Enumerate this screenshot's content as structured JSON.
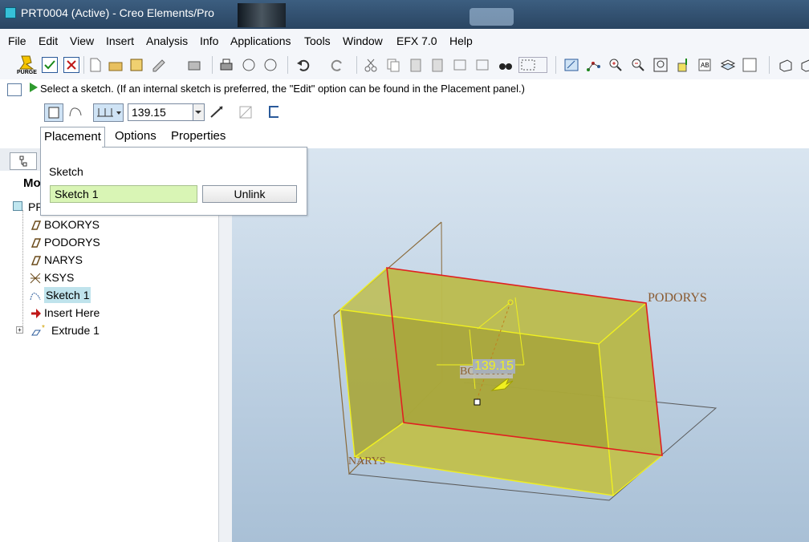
{
  "window": {
    "title": "PRT0004 (Active) - Creo Elements/Pro"
  },
  "menu": [
    "File",
    "Edit",
    "View",
    "Insert",
    "Analysis",
    "Info",
    "Applications",
    "Tools",
    "Window",
    "EFX 7.0",
    "Help"
  ],
  "toolbar": {
    "purge_label": "PURGE"
  },
  "message": {
    "prompt": "Select a sketch. (If an internal sketch is preferred, the \"Edit\" option can be found in the Placement panel.)"
  },
  "dashboard": {
    "depth_value": "139.15",
    "tabs": [
      "Placement",
      "Options",
      "Properties"
    ]
  },
  "placement_panel": {
    "sketch_label": "Sketch",
    "sketch_value": "Sketch 1",
    "unlink_label": "Unlink"
  },
  "model_tree": {
    "header": "Mo",
    "root": "PR",
    "items": [
      "BOKORYS",
      "PODORYS",
      "NARYS",
      "KSYS",
      "Sketch 1",
      "Insert Here",
      "Extrude 1"
    ]
  },
  "graphics": {
    "labels": {
      "top_plane": "PODORYS",
      "front_plane": "NARYS",
      "side_plane": "BOKORYS",
      "dimension": "139.15"
    },
    "colors": {
      "solid_fill": "#b5b54a",
      "edge": "#f0f020",
      "sketch_edge": "#e02020",
      "datum": "#8a6a3a",
      "background": "#c2d4e5"
    }
  }
}
